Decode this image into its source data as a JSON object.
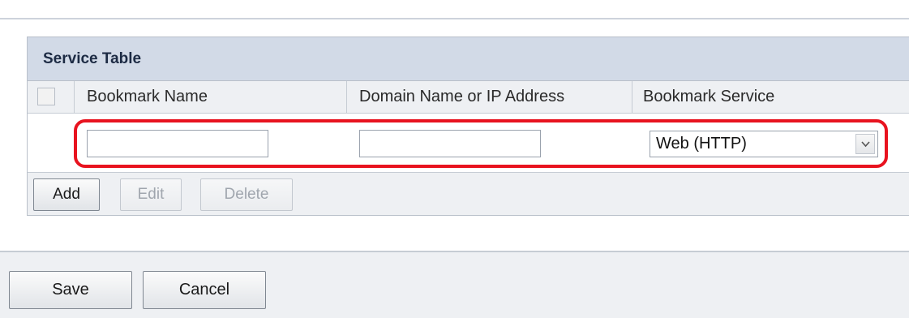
{
  "service_table": {
    "title": "Service Table",
    "columns": {
      "bookmark_name": "Bookmark Name",
      "domain": "Domain Name or IP Address",
      "service": "Bookmark Service"
    },
    "new_row": {
      "bookmark_name_value": "",
      "domain_value": "",
      "service_selected": "Web (HTTP)"
    },
    "buttons": {
      "add": "Add",
      "edit": "Edit",
      "delete": "Delete"
    }
  },
  "footer": {
    "save": "Save",
    "cancel": "Cancel"
  },
  "colors": {
    "header_bg": "#d2dae7",
    "highlight": "#e8131f",
    "panel_bg": "#eef0f3"
  },
  "icons": {
    "select_arrow": "chevron-down-icon"
  }
}
